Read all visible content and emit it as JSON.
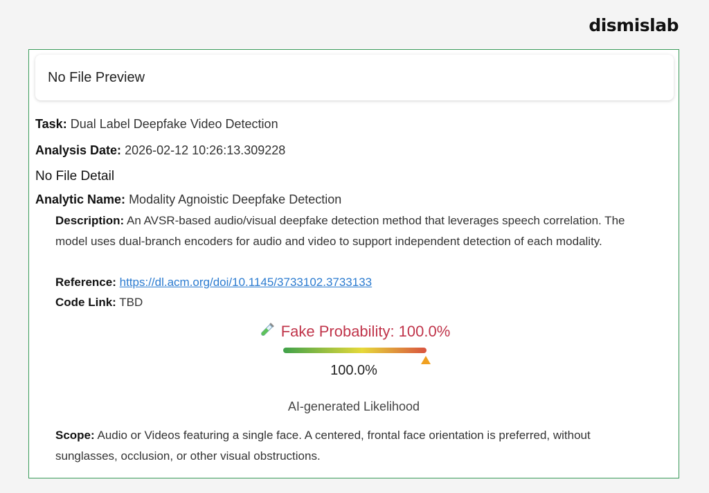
{
  "brand": {
    "logo": "dismislab"
  },
  "preview": {
    "title": "No File Preview"
  },
  "task": {
    "label": "Task:",
    "value": "Dual Label Deepfake Video Detection"
  },
  "analysis_date": {
    "label": "Analysis Date:",
    "value": "2026-02-12 10:26:13.309228"
  },
  "file_detail": "No File Detail",
  "analytic": {
    "label": "Analytic Name:",
    "value": "Modality Agnoistic Deepfake Detection",
    "description_label": "Description:",
    "description": "An AVSR-based audio/visual deepfake detection method that leverages speech correlation. The model uses dual-branch encoders for audio and video to support independent detection of each modality.",
    "reference_label": "Reference:",
    "reference": "https://dl.acm.org/doi/10.1145/3733102.3733133",
    "code_label": "Code Link:",
    "code": "TBD"
  },
  "result": {
    "heading": "Fake Probability: 100.0%",
    "gauge_value": 1.0,
    "percent": "100.0%",
    "caption": "AI-generated Likelihood",
    "colors": {
      "heading": "#c0344a",
      "low": "#3fa14a",
      "mid": "#e6d93a",
      "high": "#d9533f",
      "marker": "#f0a020"
    }
  },
  "scope": {
    "label": "Scope:",
    "value": "Audio or Videos featuring a single face. A centered, frontal face orientation is preferred, without sunglasses, occlusion, or other visual obstructions."
  },
  "icons": {
    "result": "test-tube-icon",
    "marker": "triangle-marker-icon"
  }
}
